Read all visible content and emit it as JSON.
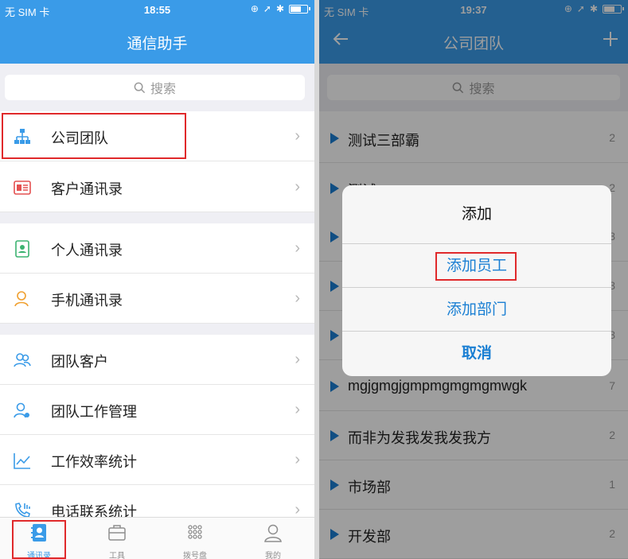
{
  "left": {
    "status": {
      "carrier": "无 SIM 卡",
      "time": "18:55"
    },
    "title": "通信助手",
    "search_label": "搜索",
    "rows": [
      {
        "label": "公司团队",
        "icon": "org-chart-icon"
      },
      {
        "label": "客户通讯录",
        "icon": "contact-card-icon"
      },
      {
        "label": "个人通讯录",
        "icon": "address-book-icon"
      },
      {
        "label": "手机通讯录",
        "icon": "phone-contact-icon"
      },
      {
        "label": "团队客户",
        "icon": "team-users-icon"
      },
      {
        "label": "团队工作管理",
        "icon": "team-manage-icon"
      },
      {
        "label": "工作效率统计",
        "icon": "line-chart-icon"
      },
      {
        "label": "电话联系统计",
        "icon": "call-stats-icon"
      }
    ],
    "tabs": [
      {
        "label": "通讯录",
        "icon": "contacts-icon"
      },
      {
        "label": "工具",
        "icon": "briefcase-icon"
      },
      {
        "label": "拨号盘",
        "icon": "dialpad-icon"
      },
      {
        "label": "我的",
        "icon": "profile-icon"
      }
    ]
  },
  "right": {
    "status": {
      "carrier": "无 SIM 卡",
      "time": "19:37"
    },
    "title": "公司团队",
    "back_icon": "back-arrow-icon",
    "add_icon": "plus-icon",
    "search_label": "搜索",
    "groups": [
      {
        "name": "测试三部霸",
        "count": "2"
      },
      {
        "name": "测试",
        "count": "2"
      },
      {
        "name": "",
        "count": "3"
      },
      {
        "name": "",
        "count": "3"
      },
      {
        "name": "",
        "count": "3"
      },
      {
        "name": "mgjgmgjgmpmgmgmgmwgk",
        "count": "7"
      },
      {
        "name": "而非为发我发我发我方",
        "count": "2"
      },
      {
        "name": "市场部",
        "count": "1"
      },
      {
        "name": "开发部",
        "count": "2"
      }
    ],
    "dialog": {
      "title": "添加",
      "add_employee": "添加员工",
      "add_department": "添加部门",
      "cancel": "取消"
    }
  },
  "colors": {
    "header": "#3a9be8",
    "accent": "#1a7fd3",
    "highlight": "#e0292b"
  }
}
